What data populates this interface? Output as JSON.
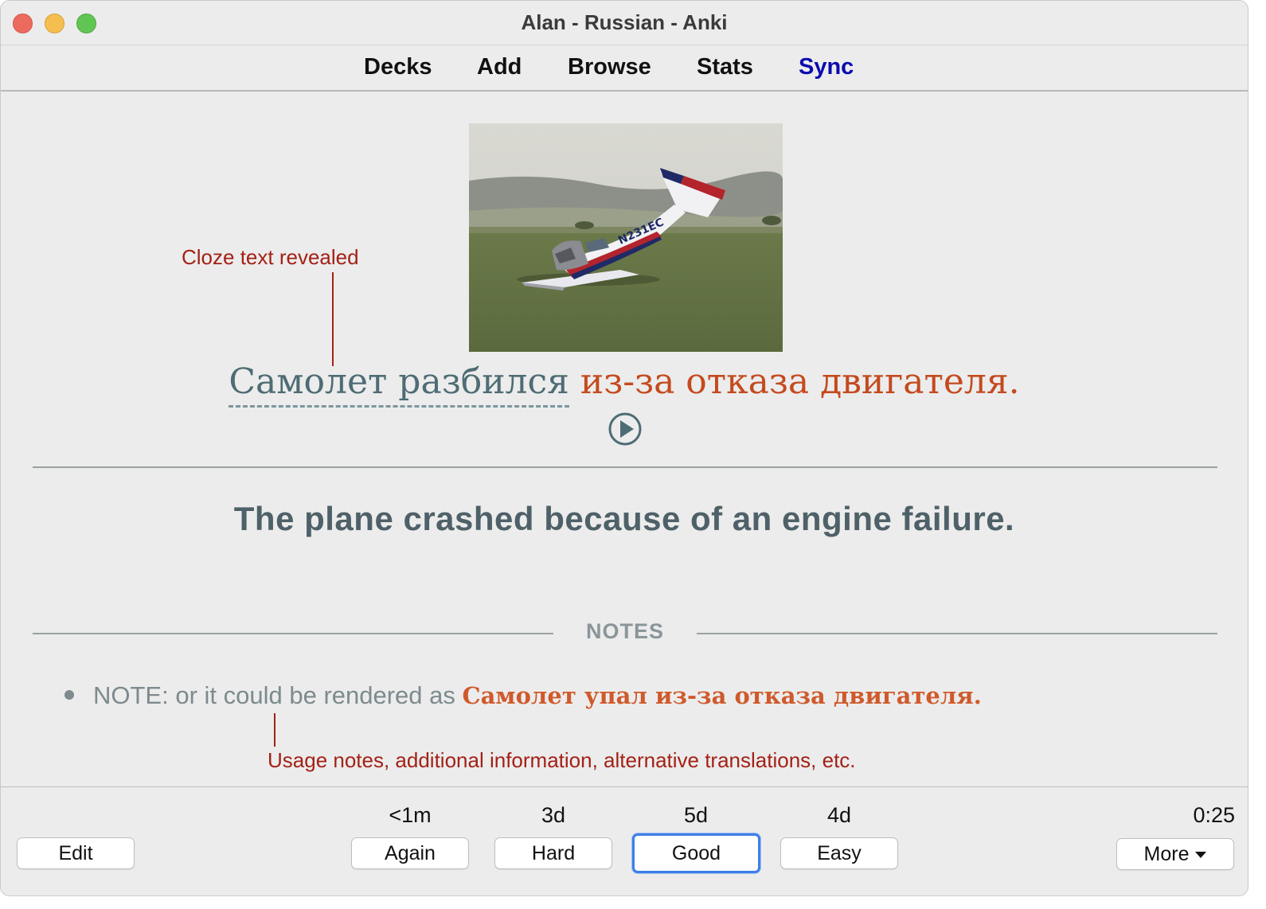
{
  "window": {
    "title": "Alan - Russian - Anki"
  },
  "toolbar": {
    "decks": "Decks",
    "add": "Add",
    "browse": "Browse",
    "stats": "Stats",
    "sync": "Sync"
  },
  "card": {
    "annotation_cloze": "Cloze text revealed",
    "sentence_known": "Самолет разбился",
    "sentence_revealed": "из-за отказа двигателя.",
    "translation": "The plane crashed because of an engine failure.",
    "notes_heading": "NOTES",
    "note_prefix": "NOTE: or it could be rendered as",
    "note_russian": "Самолет упал из-за отказа двигателя.",
    "annotation_notes": "Usage notes, additional information, alternative translations, etc."
  },
  "bottom": {
    "edit": "Edit",
    "intervals": {
      "again": "<1m",
      "hard": "3d",
      "good": "5d",
      "easy": "4d"
    },
    "again": "Again",
    "hard": "Hard",
    "good": "Good",
    "easy": "Easy",
    "timer": "0:25",
    "more": "More"
  },
  "icons": {
    "play": "play-circle-icon",
    "dropdown": "caret-down-icon"
  },
  "colors": {
    "cloze_revealed": "#c44a1e",
    "cloze_known": "#4e6c74",
    "annotation": "#a32116",
    "sync_link": "#0b0bb0",
    "focus_ring": "#3d7fe6"
  }
}
